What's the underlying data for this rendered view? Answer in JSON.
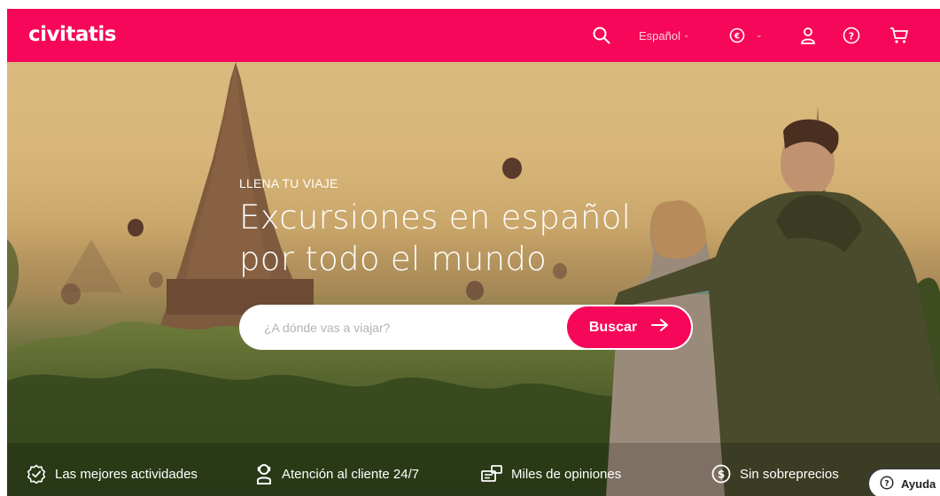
{
  "brand": {
    "logo": "civitatis",
    "accent": "#f70759"
  },
  "header": {
    "search_icon": "search-icon",
    "language": "Español",
    "currency_icon": "euro-icon",
    "user_icon": "user-icon",
    "help_icon": "help-circle-icon",
    "cart_icon": "cart-icon"
  },
  "hero": {
    "eyebrow": "LLENA TU VIAJE",
    "headline_line1": "Excursiones en español",
    "headline_line2": "por todo el mundo",
    "search": {
      "placeholder": "¿A dónde vas a viajar?",
      "button_label": "Buscar"
    }
  },
  "features": [
    {
      "icon": "badge-check-icon",
      "label": "Las mejores actividades"
    },
    {
      "icon": "headset-icon",
      "label": "Atención al cliente 24/7"
    },
    {
      "icon": "ticket-icon",
      "label": "Miles de opiniones"
    },
    {
      "icon": "dollar-circle-icon",
      "label": "Sin sobreprecios"
    }
  ],
  "help": {
    "label": "Ayuda"
  }
}
